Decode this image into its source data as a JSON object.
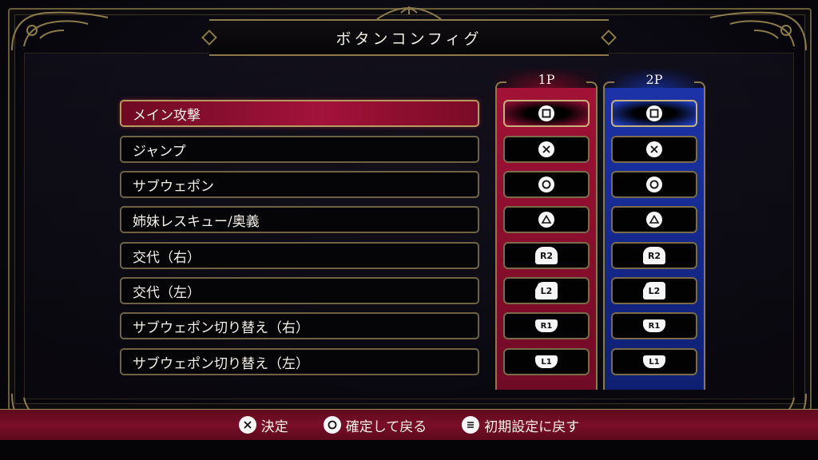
{
  "screen": {
    "title": "ボタンコンフィグ"
  },
  "columns": {
    "p1": "1P",
    "p2": "2P"
  },
  "actions": [
    {
      "label": "メイン攻撃",
      "icon": "square-icon",
      "selected": true
    },
    {
      "label": "ジャンプ",
      "icon": "cross-icon"
    },
    {
      "label": "サブウェポン",
      "icon": "circle-icon"
    },
    {
      "label": "姉妹レスキュー/奥義",
      "icon": "triangle-icon"
    },
    {
      "label": "交代（右）",
      "icon": "r2-icon",
      "button": "R2"
    },
    {
      "label": "交代（左）",
      "icon": "l2-icon",
      "button": "L2"
    },
    {
      "label": "サブウェポン切り替え（右）",
      "icon": "r1-icon",
      "button": "R1"
    },
    {
      "label": "サブウェポン切り替え（左）",
      "icon": "l1-icon",
      "button": "L1"
    }
  ],
  "footer": {
    "confirm": "決定",
    "confirm_back": "確定して戻る",
    "reset": "初期設定に戻す"
  },
  "colors": {
    "p1": "#a21237",
    "p2": "#1c33a8",
    "gold": "#8c7a4b"
  }
}
